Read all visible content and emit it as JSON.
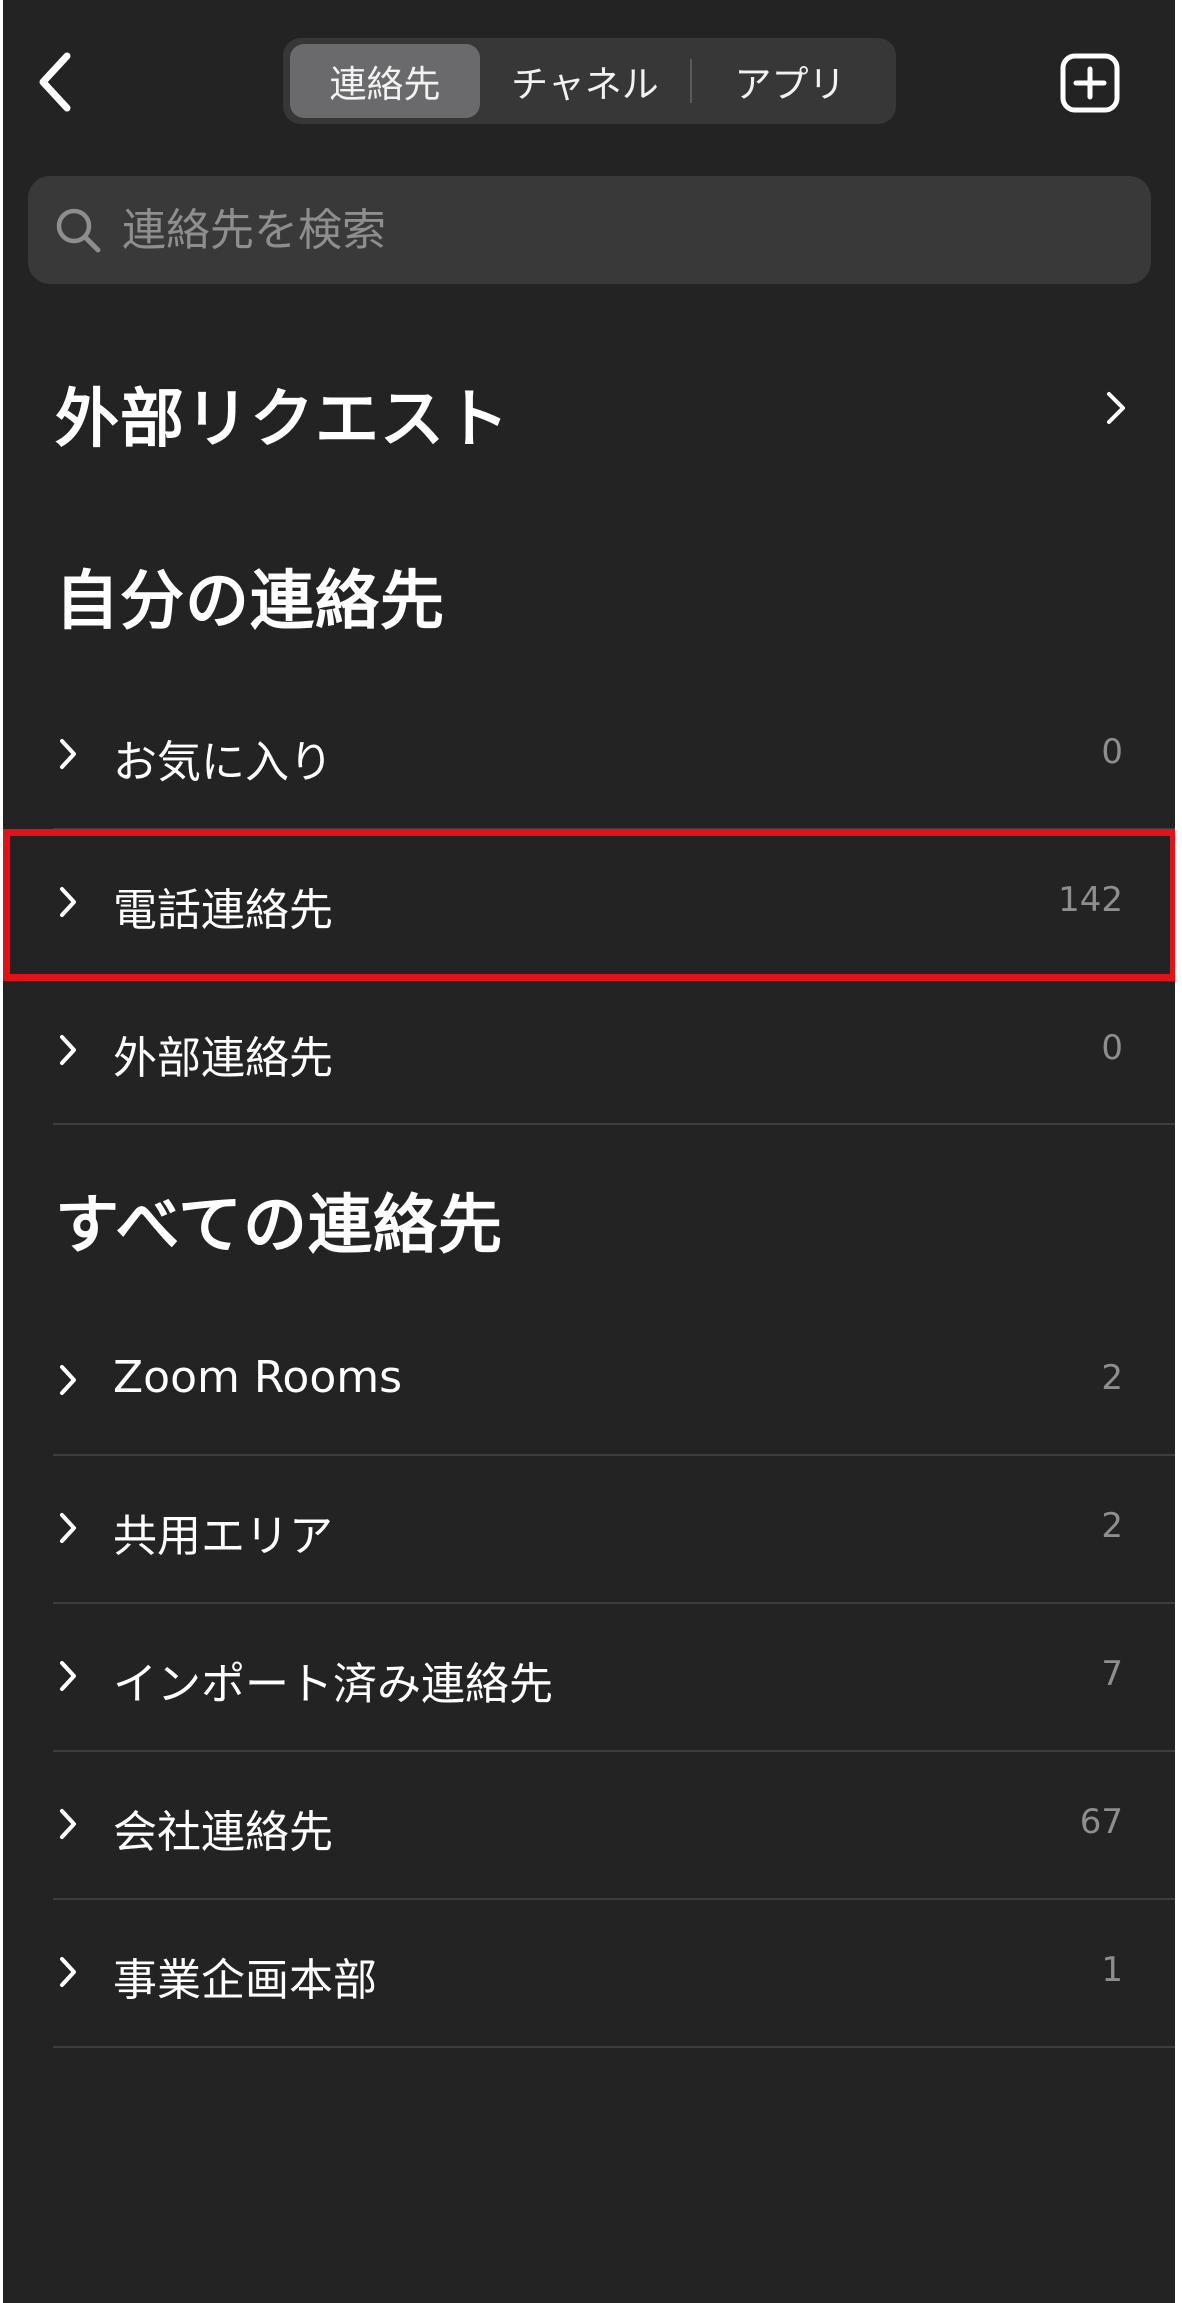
{
  "header": {
    "back_icon": "chevron-left-icon",
    "tabs": [
      {
        "label": "連絡先",
        "active": true
      },
      {
        "label": "チャネル",
        "active": false
      },
      {
        "label": "アプリ",
        "active": false
      }
    ],
    "add_icon": "plus-square-icon"
  },
  "search": {
    "placeholder": "連絡先を検索",
    "icon": "search-icon"
  },
  "external_requests": {
    "title": "外部リクエスト",
    "icon": "chevron-right-icon"
  },
  "my_contacts": {
    "title": "自分の連絡先",
    "items": [
      {
        "label": "お気に入り",
        "count": "0"
      },
      {
        "label": "電話連絡先",
        "count": "142",
        "highlighted": true
      },
      {
        "label": "外部連絡先",
        "count": "0"
      }
    ]
  },
  "all_contacts": {
    "title": "すべての連絡先",
    "items": [
      {
        "label": "Zoom Rooms",
        "count": "2"
      },
      {
        "label": "共用エリア",
        "count": "2"
      },
      {
        "label": "インポート済み連絡先",
        "count": "7"
      },
      {
        "label": "会社連絡先",
        "count": "67"
      },
      {
        "label": "事業企画本部",
        "count": "1"
      }
    ]
  },
  "colors": {
    "background": "#232323",
    "highlight_border": "#e0121a",
    "count_text": "#8e8e8e"
  }
}
